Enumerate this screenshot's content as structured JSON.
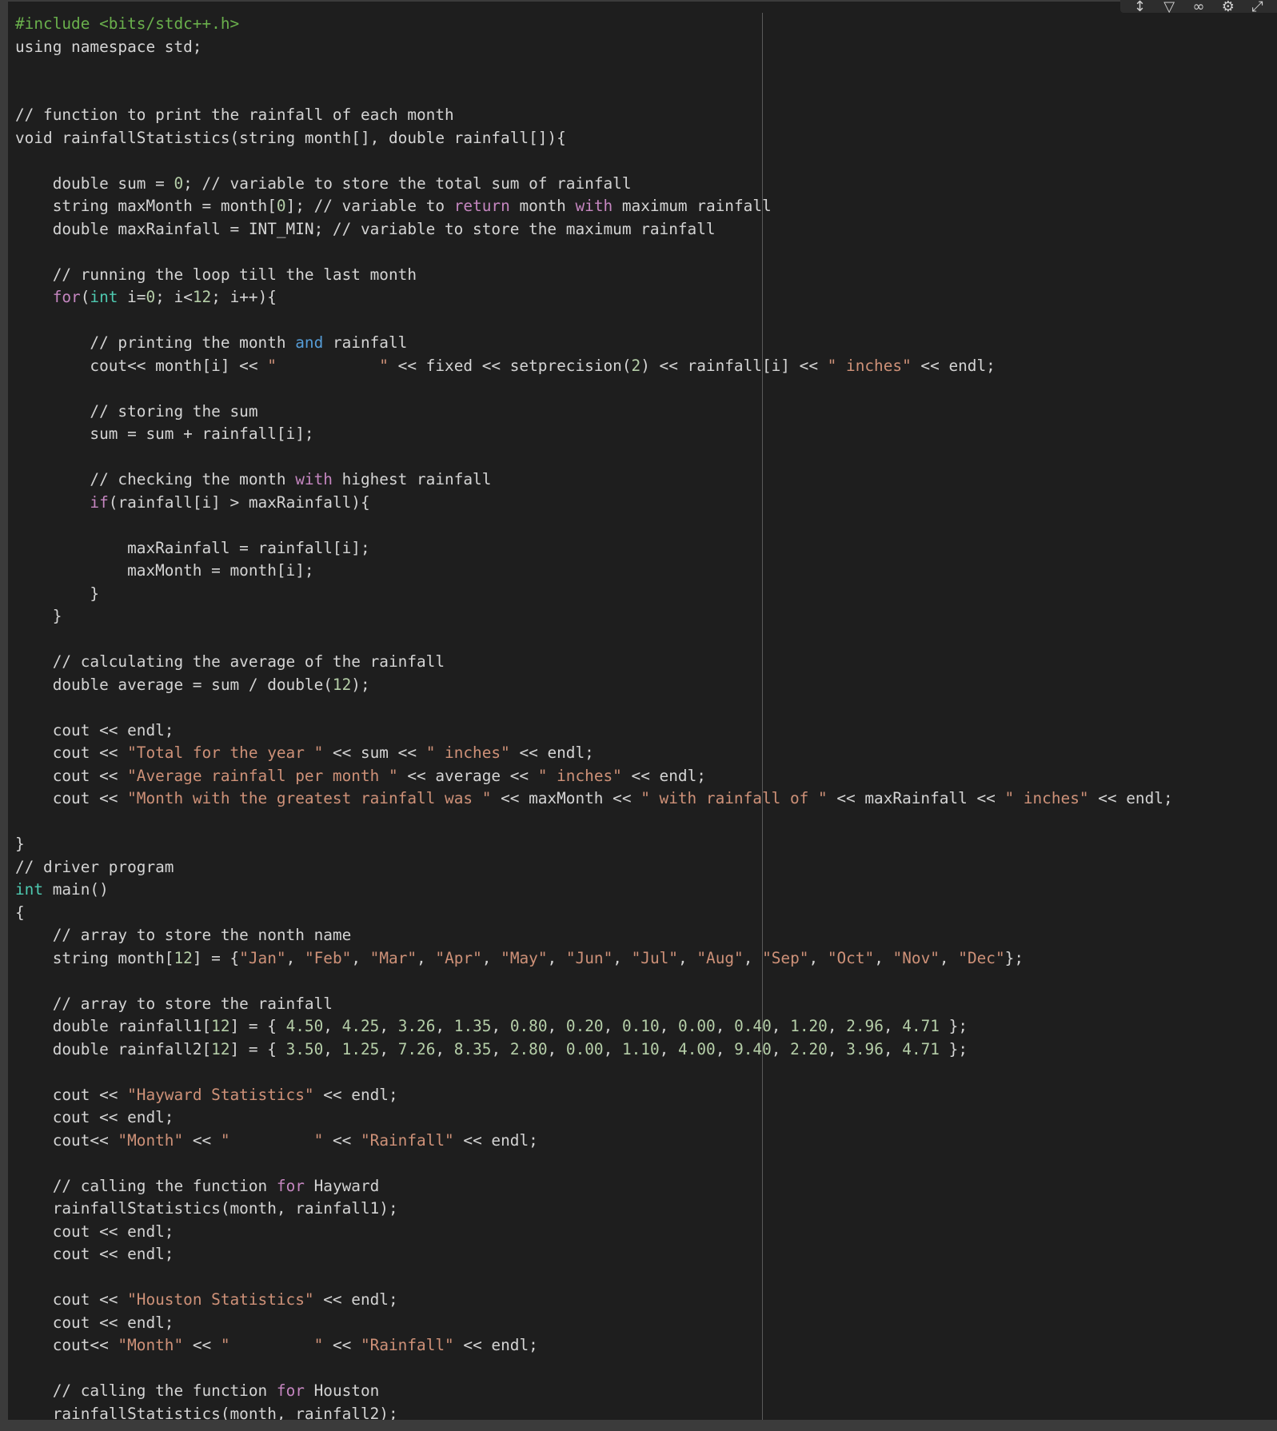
{
  "toolbar": {
    "icons": [
      "pin-icon",
      "download-icon",
      "link-icon",
      "gear-icon",
      "expand-icon"
    ]
  },
  "colors": {
    "background": "#1e1e1e",
    "plain": "#d4d4d4",
    "keyword": "#569cd6",
    "control": "#c586c0",
    "string": "#ce9178",
    "number": "#b5cea8",
    "type": "#4ec9b0",
    "preprocessor": "#6ab04c"
  },
  "code_lines": [
    [
      [
        "pp",
        "#include <bits/stdc++.h>"
      ]
    ],
    [
      [
        "x",
        "using namespace std;"
      ]
    ],
    [],
    [],
    [
      [
        "c",
        "// function to print the rainfall of each month"
      ]
    ],
    [
      [
        "x",
        "void rainfallStatistics(string month[], double rainfall[]){"
      ]
    ],
    [],
    [
      [
        "x",
        "    double sum = "
      ],
      [
        "n",
        "0"
      ],
      [
        "x",
        "; // variable to store the total sum of rainfall"
      ]
    ],
    [
      [
        "x",
        "    string maxMonth = month["
      ],
      [
        "n",
        "0"
      ],
      [
        "x",
        "]; // variable to "
      ],
      [
        "p",
        "return"
      ],
      [
        "x",
        " month "
      ],
      [
        "p",
        "with"
      ],
      [
        "x",
        " maximum rainfall"
      ]
    ],
    [
      [
        "x",
        "    double maxRainfall = INT_MIN; // variable to store the maximum rainfall"
      ]
    ],
    [],
    [
      [
        "c",
        "    // running the loop till the last month"
      ]
    ],
    [
      [
        "x",
        "    "
      ],
      [
        "p",
        "for"
      ],
      [
        "x",
        "("
      ],
      [
        "d",
        "int"
      ],
      [
        "x",
        " i="
      ],
      [
        "n",
        "0"
      ],
      [
        "x",
        "; i<"
      ],
      [
        "n",
        "12"
      ],
      [
        "x",
        "; i++){"
      ]
    ],
    [],
    [
      [
        "c",
        "        // printing the month "
      ],
      [
        "k",
        "and"
      ],
      [
        "c",
        " rainfall"
      ]
    ],
    [
      [
        "x",
        "        cout<< month[i] << "
      ],
      [
        "s",
        "\"           \""
      ],
      [
        "x",
        " << fixed << setprecision("
      ],
      [
        "n",
        "2"
      ],
      [
        "x",
        ") << rainfall[i] << "
      ],
      [
        "s",
        "\" inches\""
      ],
      [
        "x",
        " << endl;"
      ]
    ],
    [],
    [
      [
        "c",
        "        // storing the sum"
      ]
    ],
    [
      [
        "x",
        "        sum = sum + rainfall[i];"
      ]
    ],
    [],
    [
      [
        "c",
        "        // checking the month "
      ],
      [
        "p",
        "with"
      ],
      [
        "c",
        " highest rainfall"
      ]
    ],
    [
      [
        "x",
        "        "
      ],
      [
        "p",
        "if"
      ],
      [
        "x",
        "(rainfall[i] > maxRainfall){"
      ]
    ],
    [],
    [
      [
        "x",
        "            maxRainfall = rainfall[i];"
      ]
    ],
    [
      [
        "x",
        "            maxMonth = month[i];"
      ]
    ],
    [
      [
        "x",
        "        }"
      ]
    ],
    [
      [
        "x",
        "    }"
      ]
    ],
    [],
    [
      [
        "c",
        "    // calculating the average of the rainfall"
      ]
    ],
    [
      [
        "x",
        "    double average = sum / double("
      ],
      [
        "n",
        "12"
      ],
      [
        "x",
        ");"
      ]
    ],
    [],
    [
      [
        "x",
        "    cout << endl;"
      ]
    ],
    [
      [
        "x",
        "    cout << "
      ],
      [
        "s",
        "\"Total for the year \""
      ],
      [
        "x",
        " << sum << "
      ],
      [
        "s",
        "\" inches\""
      ],
      [
        "x",
        " << endl;"
      ]
    ],
    [
      [
        "x",
        "    cout << "
      ],
      [
        "s",
        "\"Average rainfall per month \""
      ],
      [
        "x",
        " << average << "
      ],
      [
        "s",
        "\" inches\""
      ],
      [
        "x",
        " << endl;"
      ]
    ],
    [
      [
        "x",
        "    cout << "
      ],
      [
        "s",
        "\"Month with the greatest rainfall was \""
      ],
      [
        "x",
        " << maxMonth << "
      ],
      [
        "s",
        "\" with rainfall of \""
      ],
      [
        "x",
        " << maxRainfall << "
      ],
      [
        "s",
        "\" inches\""
      ],
      [
        "x",
        " << endl;"
      ]
    ],
    [],
    [
      [
        "x",
        "}"
      ]
    ],
    [
      [
        "c",
        "// driver program"
      ]
    ],
    [
      [
        "d",
        "int"
      ],
      [
        "x",
        " main()"
      ]
    ],
    [
      [
        "x",
        "{"
      ]
    ],
    [
      [
        "c",
        "    // array to store the nonth name"
      ]
    ],
    [
      [
        "x",
        "    string month["
      ],
      [
        "n",
        "12"
      ],
      [
        "x",
        "] = {"
      ],
      [
        "s",
        "\"Jan\""
      ],
      [
        "x",
        ", "
      ],
      [
        "s",
        "\"Feb\""
      ],
      [
        "x",
        ", "
      ],
      [
        "s",
        "\"Mar\""
      ],
      [
        "x",
        ", "
      ],
      [
        "s",
        "\"Apr\""
      ],
      [
        "x",
        ", "
      ],
      [
        "s",
        "\"May\""
      ],
      [
        "x",
        ", "
      ],
      [
        "s",
        "\"Jun\""
      ],
      [
        "x",
        ", "
      ],
      [
        "s",
        "\"Jul\""
      ],
      [
        "x",
        ", "
      ],
      [
        "s",
        "\"Aug\""
      ],
      [
        "x",
        ", "
      ],
      [
        "s",
        "\"Sep\""
      ],
      [
        "x",
        ", "
      ],
      [
        "s",
        "\"Oct\""
      ],
      [
        "x",
        ", "
      ],
      [
        "s",
        "\"Nov\""
      ],
      [
        "x",
        ", "
      ],
      [
        "s",
        "\"Dec\""
      ],
      [
        "x",
        "};"
      ]
    ],
    [],
    [
      [
        "c",
        "    // array to store the rainfall"
      ]
    ],
    [
      [
        "x",
        "    double rainfall1["
      ],
      [
        "n",
        "12"
      ],
      [
        "x",
        "] = { "
      ],
      [
        "n",
        "4.50"
      ],
      [
        "x",
        ", "
      ],
      [
        "n",
        "4.25"
      ],
      [
        "x",
        ", "
      ],
      [
        "n",
        "3.26"
      ],
      [
        "x",
        ", "
      ],
      [
        "n",
        "1.35"
      ],
      [
        "x",
        ", "
      ],
      [
        "n",
        "0.80"
      ],
      [
        "x",
        ", "
      ],
      [
        "n",
        "0.20"
      ],
      [
        "x",
        ", "
      ],
      [
        "n",
        "0.10"
      ],
      [
        "x",
        ", "
      ],
      [
        "n",
        "0.00"
      ],
      [
        "x",
        ", "
      ],
      [
        "n",
        "0.40"
      ],
      [
        "x",
        ", "
      ],
      [
        "n",
        "1.20"
      ],
      [
        "x",
        ", "
      ],
      [
        "n",
        "2.96"
      ],
      [
        "x",
        ", "
      ],
      [
        "n",
        "4.71"
      ],
      [
        "x",
        " };"
      ]
    ],
    [
      [
        "x",
        "    double rainfall2["
      ],
      [
        "n",
        "12"
      ],
      [
        "x",
        "] = { "
      ],
      [
        "n",
        "3.50"
      ],
      [
        "x",
        ", "
      ],
      [
        "n",
        "1.25"
      ],
      [
        "x",
        ", "
      ],
      [
        "n",
        "7.26"
      ],
      [
        "x",
        ", "
      ],
      [
        "n",
        "8.35"
      ],
      [
        "x",
        ", "
      ],
      [
        "n",
        "2.80"
      ],
      [
        "x",
        ", "
      ],
      [
        "n",
        "0.00"
      ],
      [
        "x",
        ", "
      ],
      [
        "n",
        "1.10"
      ],
      [
        "x",
        ", "
      ],
      [
        "n",
        "4.00"
      ],
      [
        "x",
        ", "
      ],
      [
        "n",
        "9.40"
      ],
      [
        "x",
        ", "
      ],
      [
        "n",
        "2.20"
      ],
      [
        "x",
        ", "
      ],
      [
        "n",
        "3.96"
      ],
      [
        "x",
        ", "
      ],
      [
        "n",
        "4.71"
      ],
      [
        "x",
        " };"
      ]
    ],
    [],
    [
      [
        "x",
        "    cout << "
      ],
      [
        "s",
        "\"Hayward Statistics\""
      ],
      [
        "x",
        " << endl;"
      ]
    ],
    [
      [
        "x",
        "    cout << endl;"
      ]
    ],
    [
      [
        "x",
        "    cout<< "
      ],
      [
        "s",
        "\"Month\""
      ],
      [
        "x",
        " << "
      ],
      [
        "s",
        "\"         \""
      ],
      [
        "x",
        " << "
      ],
      [
        "s",
        "\"Rainfall\""
      ],
      [
        "x",
        " << endl;"
      ]
    ],
    [],
    [
      [
        "c",
        "    // calling the function "
      ],
      [
        "p",
        "for"
      ],
      [
        "c",
        " Hayward"
      ]
    ],
    [
      [
        "x",
        "    rainfallStatistics(month, rainfall1);"
      ]
    ],
    [
      [
        "x",
        "    cout << endl;"
      ]
    ],
    [
      [
        "x",
        "    cout << endl;"
      ]
    ],
    [],
    [
      [
        "x",
        "    cout << "
      ],
      [
        "s",
        "\"Houston Statistics\""
      ],
      [
        "x",
        " << endl;"
      ]
    ],
    [
      [
        "x",
        "    cout << endl;"
      ]
    ],
    [
      [
        "x",
        "    cout<< "
      ],
      [
        "s",
        "\"Month\""
      ],
      [
        "x",
        " << "
      ],
      [
        "s",
        "\"         \""
      ],
      [
        "x",
        " << "
      ],
      [
        "s",
        "\"Rainfall\""
      ],
      [
        "x",
        " << endl;"
      ]
    ],
    [],
    [
      [
        "c",
        "    // calling the function "
      ],
      [
        "p",
        "for"
      ],
      [
        "c",
        " Houston"
      ]
    ],
    [
      [
        "x",
        "    rainfallStatistics(month, rainfall2);"
      ]
    ]
  ]
}
